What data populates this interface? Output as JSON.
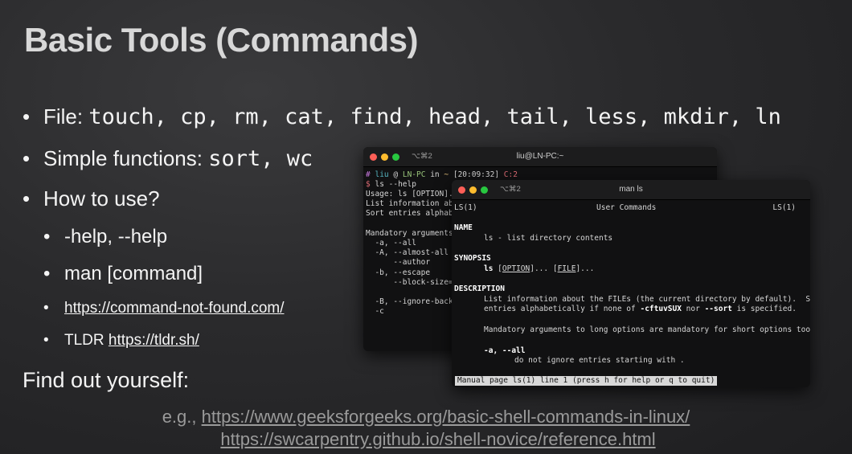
{
  "slide": {
    "title": "Basic Tools (Commands)",
    "bullets": {
      "file_label": "File: ",
      "file_cmds": "touch, cp, rm, cat, find, head, tail, less, mkdir, ln",
      "simple_label": "Simple functions: ",
      "simple_cmds": "sort, wc",
      "how_to_use": "How to use?",
      "sub_help": "-help, --help",
      "sub_man": "man [command]",
      "sub_cnf_link": "https://command-not-found.com/",
      "sub_tldr_label": "TLDR ",
      "sub_tldr_link": "https://tldr.sh/"
    },
    "find_out": "Find out yourself:",
    "eg_prefix": "e.g., ",
    "eg_link1": "https://www.geeksforgeeks.org/basic-shell-commands-in-linux/",
    "eg_link2": "https://swcarpentry.github.io/shell-novice/reference.html"
  },
  "terminal_back": {
    "shortcut": "⌥⌘2",
    "title": "liu@LN-PC:~",
    "prompt_hash": "#",
    "prompt_user": "liu",
    "prompt_at": "@",
    "prompt_host": "LN-PC",
    "prompt_in": "in",
    "prompt_dir": "~",
    "prompt_time": "[20:09:32]",
    "prompt_code": "C:2",
    "cmd_dollar": "$",
    "cmd": "ls --help",
    "lines": [
      "Usage: ls [OPTION]..",
      "List information abou",
      "Sort entries alphabet",
      "",
      "Mandatory arguments t",
      "  -a, --all",
      "  -A, --almost-all",
      "      --author",
      "  -b, --escape",
      "      --block-size=SI",
      "",
      "  -B, --ignore-backup",
      "  -c"
    ]
  },
  "terminal_front": {
    "shortcut": "⌥⌘2",
    "title": "man ls",
    "header_left": "LS(1)",
    "header_center": "User Commands",
    "header_right": "LS(1)",
    "name_heading": "NAME",
    "name_text": "ls - list directory contents",
    "synopsis_heading": "SYNOPSIS",
    "syn_cmd": "ls",
    "syn_option": "OPTION",
    "syn_file": "FILE",
    "description_heading": "DESCRIPTION",
    "desc_line1": "List information about the FILEs (the current directory by default).  Sort",
    "desc_line2_a": "entries alphabetically if none of ",
    "desc_line2_flags": "-cftuvSUX",
    "desc_line2_b": " nor ",
    "desc_line2_sort": "--sort",
    "desc_line2_c": " is specified.",
    "desc_line3": "Mandatory arguments to long options are mandatory for short options too.",
    "opt_a": "-a, --all",
    "opt_a_desc": "do not ignore entries starting with .",
    "status_bar": "Manual page ls(1) line 1 (press h for help or q to quit)"
  }
}
